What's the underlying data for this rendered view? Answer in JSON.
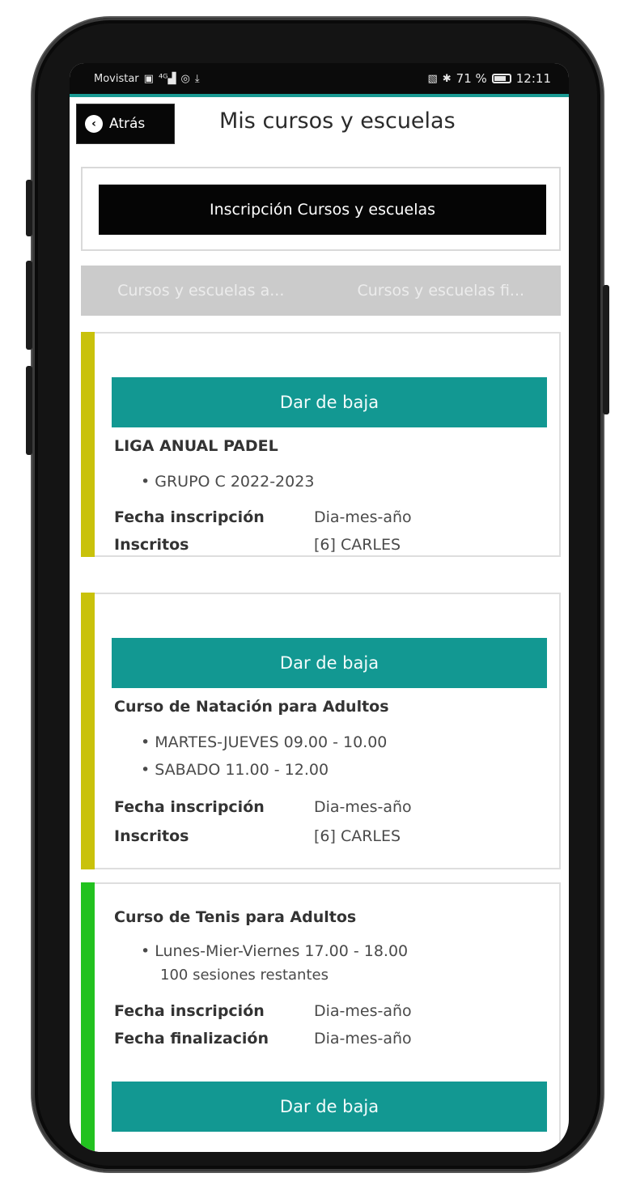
{
  "status_bar": {
    "carrier": "Movistar",
    "battery": "71 %",
    "time": "12:11"
  },
  "header": {
    "back_label": "Atrás",
    "title": "Mis cursos y escuelas"
  },
  "enroll_button": "Inscripción Cursos y escuelas",
  "tabs": [
    {
      "label": "Cursos y escuelas a..."
    },
    {
      "label": "Cursos y escuelas fi..."
    }
  ],
  "colors": {
    "teal": "#129892",
    "bar_yellow": "#c9c20b",
    "bar_green": "#22c21f"
  },
  "cards": [
    {
      "action": "Dar de baja",
      "title": "LIGA ANUAL PADEL",
      "bullets": [
        "GRUPO C 2022-2023"
      ],
      "fields": [
        {
          "label": "Fecha inscripción",
          "value": "Dia-mes-año"
        },
        {
          "label": "Inscritos",
          "value": "[6] CARLES"
        }
      ]
    },
    {
      "action": "Dar de baja",
      "title": "Curso de Natación para Adultos",
      "bullets": [
        "MARTES-JUEVES 09.00 - 10.00",
        "SABADO 11.00 - 12.00"
      ],
      "fields": [
        {
          "label": "Fecha inscripción",
          "value": "Dia-mes-año"
        },
        {
          "label": "Inscritos",
          "value": "[6] CARLES"
        }
      ]
    },
    {
      "title": "Curso de Tenis para Adultos",
      "bullets": [
        "Lunes-Mier-Viernes 17.00 - 18.00"
      ],
      "bullet_sub": "100 sesiones restantes",
      "fields": [
        {
          "label": "Fecha inscripción",
          "value": "Dia-mes-año"
        },
        {
          "label": "Fecha finalización",
          "value": "Dia-mes-año"
        }
      ],
      "action": "Dar de baja"
    }
  ]
}
